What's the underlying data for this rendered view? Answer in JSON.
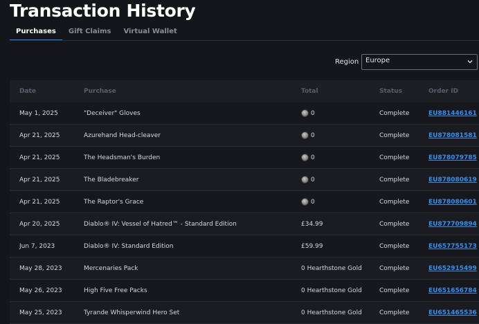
{
  "page_title": "Transaction History",
  "tabs": [
    {
      "label": "Purchases",
      "active": true
    },
    {
      "label": "Gift Claims",
      "active": false
    },
    {
      "label": "Virtual Wallet",
      "active": false
    }
  ],
  "region": {
    "label": "Region",
    "value": "Europe"
  },
  "table": {
    "headers": {
      "date": "Date",
      "purchase": "Purchase",
      "total": "Total",
      "status": "Status",
      "order_id": "Order ID"
    },
    "rows": [
      {
        "date": "May 1, 2025",
        "purchase": "\"Deceiver\" Gloves",
        "total": "0",
        "coin": true,
        "status": "Complete",
        "order_id": "EU881446161"
      },
      {
        "date": "Apr 21, 2025",
        "purchase": "Azurehand Head-cleaver",
        "total": "0",
        "coin": true,
        "status": "Complete",
        "order_id": "EU878081581"
      },
      {
        "date": "Apr 21, 2025",
        "purchase": "The Headsman's Burden",
        "total": "0",
        "coin": true,
        "status": "Complete",
        "order_id": "EU878079785"
      },
      {
        "date": "Apr 21, 2025",
        "purchase": "The Bladebreaker",
        "total": "0",
        "coin": true,
        "status": "Complete",
        "order_id": "EU878080619"
      },
      {
        "date": "Apr 21, 2025",
        "purchase": "The Raptor's Grace",
        "total": "0",
        "coin": true,
        "status": "Complete",
        "order_id": "EU878080601"
      },
      {
        "date": "Apr 20, 2025",
        "purchase": "Diablo® IV: Vessel of Hatred™ - Standard Edition",
        "total": "£34.99",
        "coin": false,
        "status": "Complete",
        "order_id": "EU877709894"
      },
      {
        "date": "Jun 7, 2023",
        "purchase": "Diablo® IV: Standard Edition",
        "total": "£59.99",
        "coin": false,
        "status": "Complete",
        "order_id": "EU657755173"
      },
      {
        "date": "May 28, 2023",
        "purchase": "Mercenaries Pack",
        "total": "0 Hearthstone Gold",
        "coin": false,
        "status": "Complete",
        "order_id": "EU652915499"
      },
      {
        "date": "May 26, 2023",
        "purchase": "High Five Free Packs",
        "total": "0 Hearthstone Gold",
        "coin": false,
        "status": "Complete",
        "order_id": "EU651656784"
      },
      {
        "date": "May 25, 2023",
        "purchase": "Tyrande Whisperwind Hero Set",
        "total": "0 Hearthstone Gold",
        "coin": false,
        "status": "Complete",
        "order_id": "EU651465536"
      }
    ]
  },
  "colors": {
    "accent": "#2f7fe0",
    "link": "#3a8ee6",
    "background": "#15161b"
  },
  "icons": {
    "coin": "gold-coin-icon",
    "chevron": "chevron-down-icon"
  }
}
